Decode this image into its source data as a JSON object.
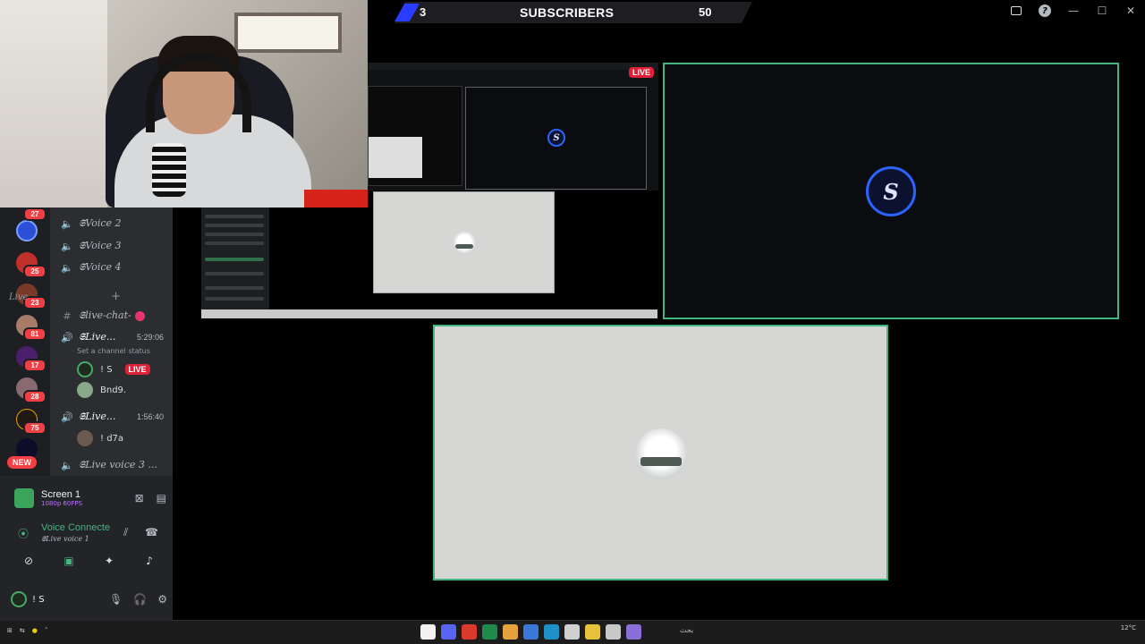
{
  "top_bar": {
    "subscribers_current": "3",
    "subscribers_label": "SUBSCRIBERS",
    "subscribers_goal": "50"
  },
  "stream": {
    "live_badge": "LIVE",
    "logo_letter": "S"
  },
  "sidebar": {
    "server_badges": [
      "27",
      "25",
      "23",
      "81",
      "17",
      "28",
      "75"
    ],
    "new_badge": "NEW",
    "voice_channels_top": [
      "𝕾Voice 2",
      "𝕾Voice 3",
      "𝕾Voice 4"
    ],
    "category": "Live",
    "text_channel": "𝕾live-chat-",
    "live_channel_1": {
      "name": "𝕾Live...",
      "time": "5:29:06",
      "status": "Set a channel status"
    },
    "members": [
      {
        "name": "! S",
        "badge": "LIVE"
      },
      {
        "name": "Bnd9."
      }
    ],
    "live_channel_2": {
      "name": "𝕾Live...",
      "time": "1:56:40"
    },
    "member_3": {
      "name": "! d7a"
    },
    "live_channel_3": {
      "name": "𝕾Live voice 3 ..."
    }
  },
  "voice_panel": {
    "screen_title": "Screen 1",
    "screen_sub": "1080p 60FPS",
    "vc_title": "Voice Connecte",
    "vc_sub": "𝕾Live voice 1",
    "user_name": "! S"
  },
  "taskbar": {
    "search_label": "بحث",
    "tray_temp": "12°C"
  },
  "colors": {
    "accent_green": "#43b581",
    "live_red": "#e21f38",
    "discord_bg": "#2b2d31",
    "subscriber_stripe": "#2a3cff"
  }
}
